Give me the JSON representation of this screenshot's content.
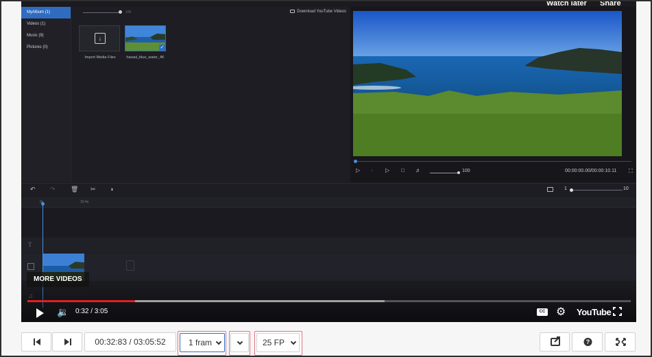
{
  "editor": {
    "sidebar": [
      {
        "label": "MyAlbum (1)",
        "active": true
      },
      {
        "label": "Videos (1)",
        "active": false
      },
      {
        "label": "Music (9)",
        "active": false
      },
      {
        "label": "Pictures (0)",
        "active": false
      }
    ],
    "media": {
      "zoom_label": "100",
      "download_youtube": "Download YouTube Videos",
      "import_label": "Import Media Files",
      "clip_label": "hawaii_blue_water_4K"
    },
    "preview": {
      "volume": "100",
      "timecode": "00:00:00.00/00:00:10.11"
    },
    "timeline": {
      "ruler_start": "0s",
      "ruler_mark": "10.4s",
      "zoom_min": "1",
      "zoom_max": "10"
    }
  },
  "youtube": {
    "watch_later": "Watch later",
    "share": "Share",
    "more_videos": "MORE VIDEOS",
    "time": "0:32 / 3:05",
    "logo": "YouTube",
    "cc": "CC",
    "progress_played": 0.178,
    "progress_buffered": 0.592
  },
  "controls": {
    "timecode": "00:32:83 / 03:05:52",
    "step_select": "1 fram",
    "fps_select": "25 FP",
    "highlight_color": "#e07080",
    "step_border_color": "#2f6cc0"
  }
}
